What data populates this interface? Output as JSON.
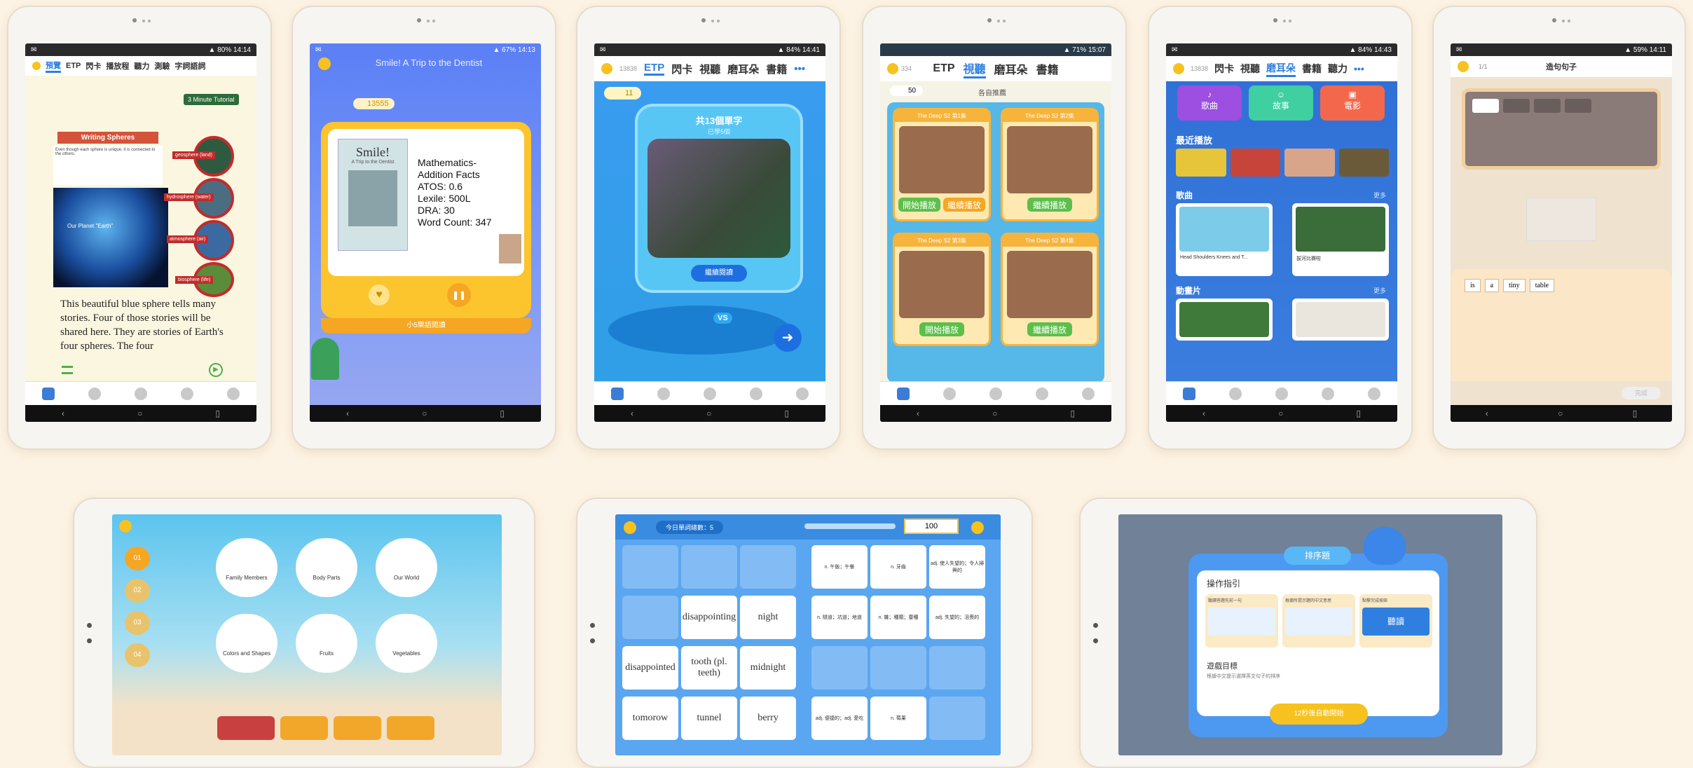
{
  "tablet1": {
    "tabs": [
      "預覽",
      "ETP",
      "閃卡",
      "播放程",
      "聽力",
      "測驗",
      "字詞語詞"
    ],
    "tutorial": "3 Minute Tutorial",
    "heading": "Writing Spheres",
    "earth_label": "Our Planet \"Earth\"",
    "labels": [
      "geosphere (land)",
      "hydrosphere (water)",
      "atmosphere (air)",
      "biosphere (life)"
    ],
    "body": "This beautiful blue sphere tells many stories. Four of those stories will be shared here. They are stories of Earth's four spheres. The four"
  },
  "tablet2": {
    "header_text": "Smile! A Trip to the Dentist",
    "coins": "13555",
    "book_cover_title": "Smile!",
    "book_cover_sub": "A Trip to the Dentist",
    "info": [
      "Mathematics-",
      "Addition Facts",
      "ATOS: 0.6",
      "Lexile: 500L",
      "DRA: 30",
      "Word Count: 347"
    ],
    "footer": "小5樂語閱讀"
  },
  "tablet3": {
    "coins": "13838",
    "tabs": [
      "ETP",
      "閃卡",
      "視聽",
      "磨耳朵",
      "書籍"
    ],
    "count": "11",
    "card_title": "共13個單字",
    "card_sub": "已學5個",
    "review_btn": "繼續閱讀",
    "vs": "VS"
  },
  "tablet4": {
    "coins": "334",
    "tabs": [
      "ETP",
      "視聽",
      "磨耳朵",
      "書籍"
    ],
    "count": "50",
    "filter": "各自推薦",
    "episodes": [
      {
        "title": "The Deep S2 第1集",
        "btns": [
          "開始播放",
          "繼續播放"
        ]
      },
      {
        "title": "The Deep S2 第2集",
        "btns": [
          "繼續播放"
        ]
      },
      {
        "title": "The Deep S2 第3集",
        "btns": [
          "開始播放"
        ]
      },
      {
        "title": "The Deep S2 第4集",
        "btns": [
          "繼續播放"
        ]
      }
    ]
  },
  "tablet5": {
    "coins": "13838",
    "tabs": [
      "閃卡",
      "視聽",
      "磨耳朵",
      "書籍",
      "聽力"
    ],
    "cats": [
      "歌曲",
      "故事",
      "電影"
    ],
    "recent": "最近播放",
    "songs": "歌曲",
    "more": "更多",
    "song_items": [
      "Head Shoulders Knees and T...",
      "拔河比賽啦"
    ],
    "cartoons": "動畫片"
  },
  "tablet6": {
    "progress": "1/1",
    "title": "造句句子",
    "words": [
      "is",
      "a",
      "tiny",
      "table"
    ],
    "submit": "完成"
  },
  "tablet7": {
    "levels": [
      "01",
      "02",
      "03",
      "04"
    ],
    "topics": [
      "Family Members",
      "Body Parts",
      "Our World",
      "Colors and Shapes",
      "Fruits",
      "Vegetables"
    ]
  },
  "tablet8": {
    "header": "今日單詞總數：5",
    "score": "100",
    "rows": [
      [
        "",
        "",
        "",
        "n. 午飯；午餐",
        "n. 牙齒",
        "adj. 使人失望的；令人掃興的"
      ],
      [
        "",
        "disappointing",
        "night",
        "n. 隧道；坑道；地道",
        "n. 雜；種類；蚕種",
        "adj. 失望的；沮喪的"
      ],
      [
        "disappointed",
        "tooth (pl. teeth)",
        "midnight",
        "",
        "",
        ""
      ],
      [
        "tomorow",
        "tunnel",
        "berry",
        "adj. 便捷的；adj. 愛吃",
        "n. 莓果",
        ""
      ]
    ]
  },
  "tablet9": {
    "badge": "排序題",
    "guide": "操作指引",
    "steps": [
      "聽讀答題先前一句",
      "根據所提示題的中文意思",
      "點擊完成按鈕"
    ],
    "listen": "聽讀",
    "goal_title": "遊戲目標",
    "goal_text": "根據中文提示選擇英文句子的排序",
    "start": "12秒後自動開始"
  }
}
